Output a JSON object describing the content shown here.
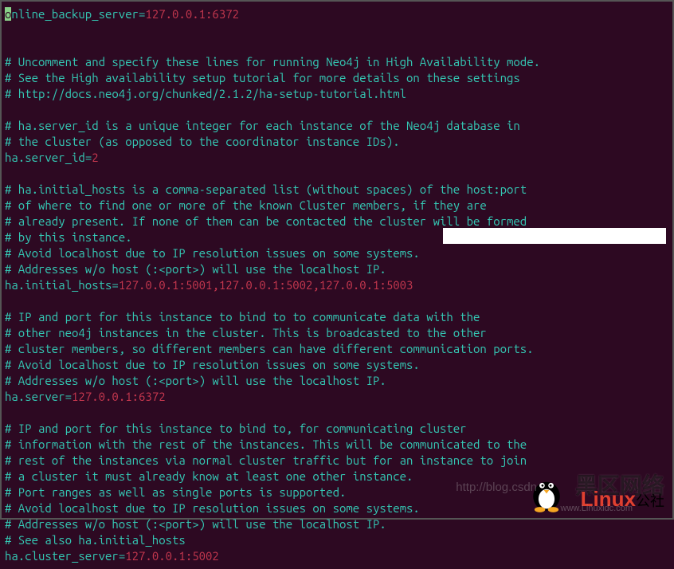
{
  "lines": [
    {
      "type": "assign-cursor",
      "cursor": "o",
      "key_rest": "nline_backup_server",
      "value": "127.0.0.1:6372"
    },
    {
      "type": "blank"
    },
    {
      "type": "blank"
    },
    {
      "type": "comment",
      "text": "# Uncomment and specify these lines for running Neo4j in High Availability mode."
    },
    {
      "type": "comment",
      "text": "# See the High availability setup tutorial for more details on these settings"
    },
    {
      "type": "comment",
      "text": "# http://docs.neo4j.org/chunked/2.1.2/ha-setup-tutorial.html"
    },
    {
      "type": "blank"
    },
    {
      "type": "comment",
      "text": "# ha.server_id is a unique integer for each instance of the Neo4j database in"
    },
    {
      "type": "comment",
      "text": "# the cluster (as opposed to the coordinator instance IDs)."
    },
    {
      "type": "assign",
      "key": "ha.server_id",
      "value": "2"
    },
    {
      "type": "blank"
    },
    {
      "type": "comment",
      "text": "# ha.initial_hosts is a comma-separated list (without spaces) of the host:port"
    },
    {
      "type": "comment",
      "text": "# of where to find one or more of the known Cluster members, if they are"
    },
    {
      "type": "comment",
      "text": "# already present. If none of them can be contacted the cluster will be formed"
    },
    {
      "type": "comment",
      "text": "# by this instance."
    },
    {
      "type": "comment",
      "text": "# Avoid localhost due to IP resolution issues on some systems."
    },
    {
      "type": "comment",
      "text": "# Addresses w/o host (:<port>) will use the localhost IP."
    },
    {
      "type": "assign",
      "key": "ha.initial_hosts",
      "value": "127.0.0.1:5001,127.0.0.1:5002,127.0.0.1:5003"
    },
    {
      "type": "blank"
    },
    {
      "type": "comment",
      "text": "# IP and port for this instance to bind to to communicate data with the"
    },
    {
      "type": "comment",
      "text": "# other neo4j instances in the cluster. This is broadcasted to the other"
    },
    {
      "type": "comment",
      "text": "# cluster members, so different members can have different communication ports."
    },
    {
      "type": "comment",
      "text": "# Avoid localhost due to IP resolution issues on some systems."
    },
    {
      "type": "comment",
      "text": "# Addresses w/o host (:<port>) will use the localhost IP."
    },
    {
      "type": "assign",
      "key": "ha.server",
      "value": "127.0.0.1:6372"
    },
    {
      "type": "blank"
    },
    {
      "type": "comment",
      "text": "# IP and port for this instance to bind to, for communicating cluster"
    },
    {
      "type": "comment",
      "text": "# information with the rest of the instances. This will be communicated to the"
    },
    {
      "type": "comment",
      "text": "# rest of the instances via normal cluster traffic but for an instance to join"
    },
    {
      "type": "comment",
      "text": "# a cluster it must already know at least one other instance."
    },
    {
      "type": "comment",
      "text": "# Port ranges as well as single ports is supported."
    },
    {
      "type": "comment",
      "text": "# Avoid localhost due to IP resolution issues on some systems."
    },
    {
      "type": "comment",
      "text": "# Addresses w/o host (:<port>) will use the localhost IP."
    },
    {
      "type": "comment",
      "text": "# See also ha.initial_hosts"
    },
    {
      "type": "assign",
      "key": "ha.cluster_server",
      "value": "127.0.0.1:5002"
    }
  ],
  "watermark": {
    "url": "http://blog.csdn",
    "text": "黑区网络",
    "brand": "Linux",
    "brand_sub": "公社",
    "brand_url": "www.Linuxidc.com"
  }
}
